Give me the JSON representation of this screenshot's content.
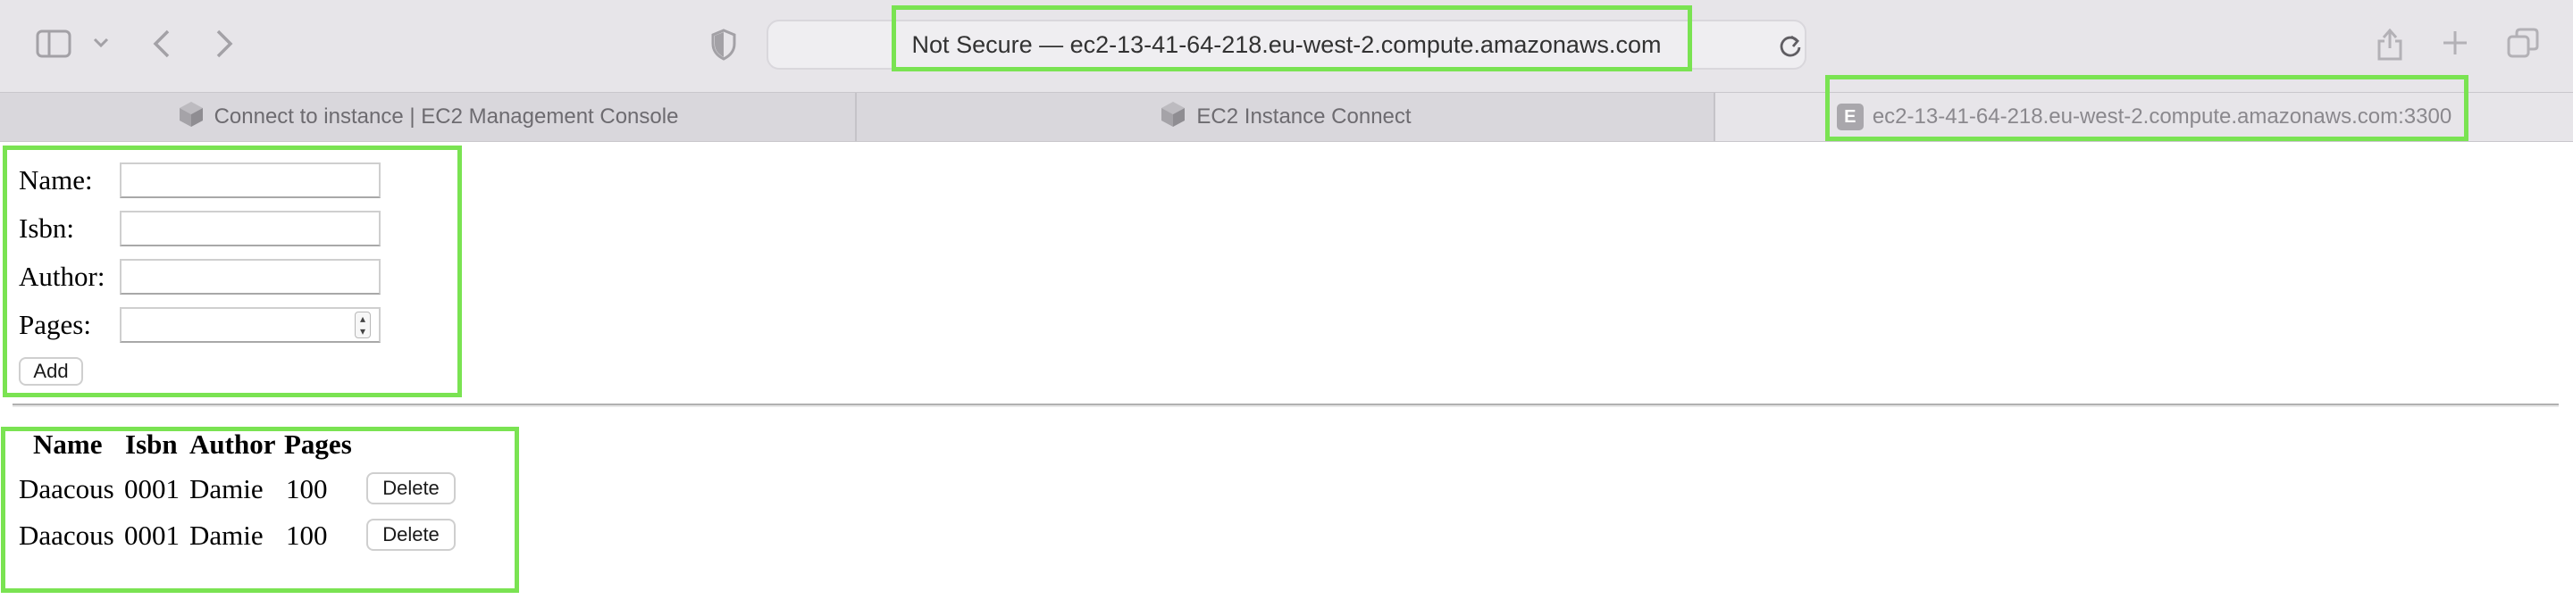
{
  "browser": {
    "address": "Not Secure — ec2-13-41-64-218.eu-west-2.compute.amazonaws.com",
    "tabs": [
      {
        "label": "Connect to instance | EC2 Management Console"
      },
      {
        "label": "EC2 Instance Connect"
      },
      {
        "label": "ec2-13-41-64-218.eu-west-2.compute.amazonaws.com:3300",
        "favicon_letter": "E"
      }
    ]
  },
  "form": {
    "name_label": "Name:",
    "isbn_label": "Isbn:",
    "author_label": "Author:",
    "pages_label": "Pages:",
    "name_value": "",
    "isbn_value": "",
    "author_value": "",
    "pages_value": "",
    "add_label": "Add"
  },
  "table": {
    "headers": [
      "Name",
      "Isbn",
      "Author",
      "Pages"
    ],
    "rows": [
      {
        "name": "Daacous",
        "isbn": "0001",
        "author": "Damie",
        "pages": "100",
        "action": "Delete"
      },
      {
        "name": "Daacous",
        "isbn": "0001",
        "author": "Damie",
        "pages": "100",
        "action": "Delete"
      }
    ]
  },
  "colors": {
    "highlight": "#7ae352",
    "toolbar": "#e7e5e9",
    "tabbar": "#d9d7dc"
  },
  "icons": [
    "sidebar-icon",
    "chevron-down-icon",
    "back-icon",
    "forward-icon",
    "privacy-shield-icon",
    "reload-icon",
    "share-icon",
    "new-tab-icon",
    "tab-overview-icon",
    "aws-cube-icon"
  ]
}
